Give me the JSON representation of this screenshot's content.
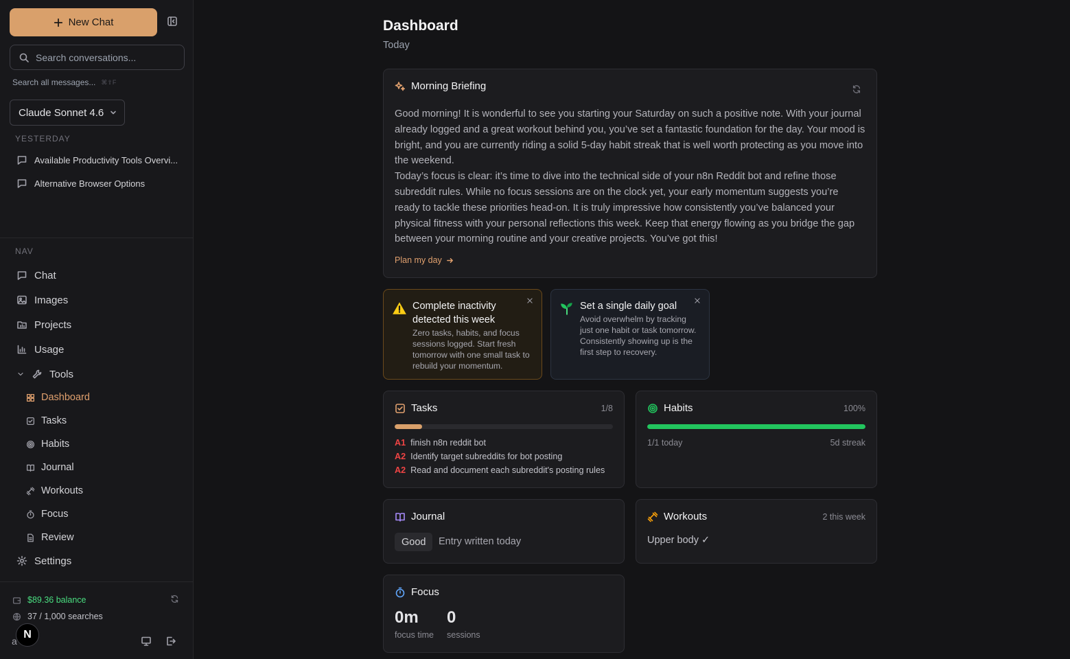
{
  "sidebar": {
    "new_chat_label": "New Chat",
    "search_placeholder": "Search conversations...",
    "search_all_label": "Search all messages...",
    "search_all_shortcut": "⌘⇧F",
    "model_name": "Claude Sonnet 4.6",
    "history_group_label": "YESTERDAY",
    "conversations": [
      {
        "title": "Available Productivity Tools Overvi..."
      },
      {
        "title": "Alternative Browser Options"
      }
    ],
    "nav_label": "NAV",
    "nav_items": {
      "chat": "Chat",
      "images": "Images",
      "projects": "Projects",
      "usage": "Usage",
      "tools": "Tools",
      "settings": "Settings"
    },
    "tools_items": {
      "dashboard": "Dashboard",
      "tasks": "Tasks",
      "habits": "Habits",
      "journal": "Journal",
      "workouts": "Workouts",
      "focus": "Focus",
      "review": "Review"
    },
    "balance": "$89.36 balance",
    "searches": "37 / 1,000 searches",
    "avatar_letter": "N",
    "footer_letter": "a"
  },
  "main": {
    "title": "Dashboard",
    "subtitle": "Today",
    "briefing": {
      "title": "Morning Briefing",
      "paragraph1": "Good morning! It is wonderful to see you starting your Saturday on such a positive note. With your journal already logged and a great workout behind you, you’ve set a fantastic foundation for the day. Your mood is bright, and you are currently riding a solid 5-day habit streak that is well worth protecting as you move into the weekend.",
      "paragraph2": "Today’s focus is clear: it’s time to dive into the technical side of your n8n Reddit bot and refine those subreddit rules. While no focus sessions are on the clock yet, your early momentum suggests you’re ready to tackle these priorities head-on. It is truly impressive how consistently you’ve balanced your physical fitness with your personal reflections this week. Keep that energy flowing as you bridge the gap between your morning routine and your creative projects. You’ve got this!",
      "plan_link": "Plan my day"
    },
    "alerts": [
      {
        "title": "Complete inactivity detected this week",
        "body": "Zero tasks, habits, and focus sessions logged. Start fresh tomorrow with one small task to rebuild your momentum."
      },
      {
        "title": "Set a single daily goal",
        "body": "Avoid overwhelm by tracking just one habit or task tomorrow. Consistently showing up is the first step to recovery."
      }
    ],
    "tasks": {
      "title": "Tasks",
      "count": "1/8",
      "progress": 0.125,
      "items": [
        {
          "priority": "A1",
          "text": "finish n8n reddit bot"
        },
        {
          "priority": "A2",
          "text": "Identify target subreddits for bot posting"
        },
        {
          "priority": "A2",
          "text": "Read and document each subreddit's posting rules"
        }
      ]
    },
    "habits": {
      "title": "Habits",
      "percent": "100%",
      "progress": 1.0,
      "today": "1/1 today",
      "streak": "5d streak"
    },
    "journal": {
      "title": "Journal",
      "mood": "Good",
      "status": "Entry written today"
    },
    "workouts": {
      "title": "Workouts",
      "week_count": "2 this week",
      "latest": "Upper body ✓"
    },
    "focus": {
      "title": "Focus",
      "time_value": "0m",
      "time_label": "focus time",
      "sessions_value": "0",
      "sessions_label": "sessions"
    }
  },
  "colors": {
    "accent": "#d9a06b",
    "habit_green": "#22c55e",
    "balance_green": "#4ade80",
    "priority_red": "#ef4444",
    "journal_purple": "#a78bfa",
    "focus_blue": "#60a5fa"
  }
}
